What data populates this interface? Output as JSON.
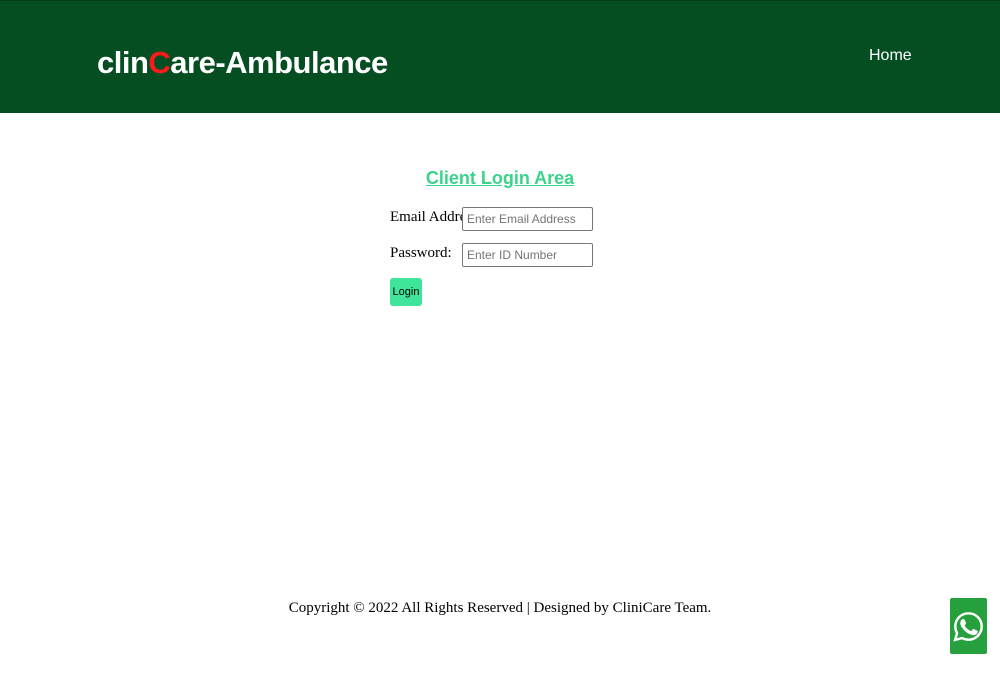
{
  "brand": {
    "prefix": "clin",
    "accent": "C",
    "suffix": "are-Ambulance"
  },
  "nav": {
    "home_label": "Home"
  },
  "login": {
    "title": "Client Login Area",
    "email_label": "Email Address:",
    "email_placeholder": "Enter Email Address",
    "email_value": "",
    "password_label": "Password:",
    "password_placeholder": "Enter ID Number",
    "password_value": "",
    "submit_label": "Login"
  },
  "footer": {
    "copyright": "Copyright © 2022 All Rights Reserved | Designed by CliniCare Team."
  },
  "widgets": {
    "whatsapp_icon": "whatsapp-icon"
  },
  "colors": {
    "header_bg": "#054e22",
    "brand_accent": "#ff1a1a",
    "title": "#3ad38a",
    "button_bg": "#3ee59a",
    "whatsapp_bg": "#25a03c"
  }
}
